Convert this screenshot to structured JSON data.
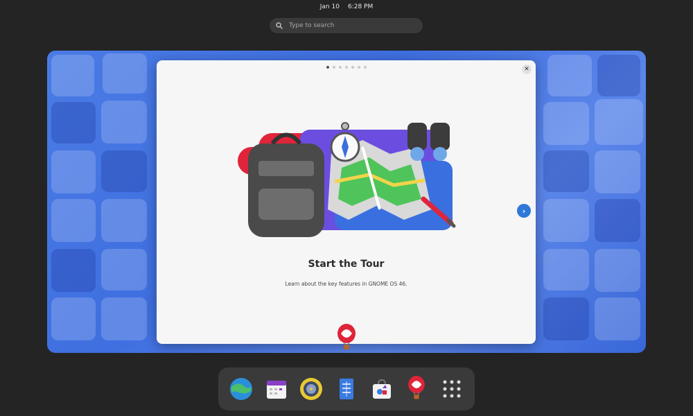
{
  "topbar": {
    "date": "Jan 10",
    "time": "6:28 PM"
  },
  "search": {
    "placeholder": "Type to search"
  },
  "tour": {
    "pages_total": 7,
    "current_page": 1,
    "title": "Start the Tour",
    "description": "Learn about the key features in GNOME OS 46."
  },
  "dock": {
    "apps": [
      {
        "icon": "web-browser-icon"
      },
      {
        "icon": "calendar-icon"
      },
      {
        "icon": "music-player-icon"
      },
      {
        "icon": "text-editor-icon"
      },
      {
        "icon": "software-store-icon"
      },
      {
        "icon": "tour-balloon-icon"
      },
      {
        "icon": "app-grid-icon"
      }
    ]
  },
  "colors": {
    "accent": "#2f78d8",
    "panel": "#242424",
    "dock": "#3a3a3a",
    "window": "#f6f6f6"
  }
}
